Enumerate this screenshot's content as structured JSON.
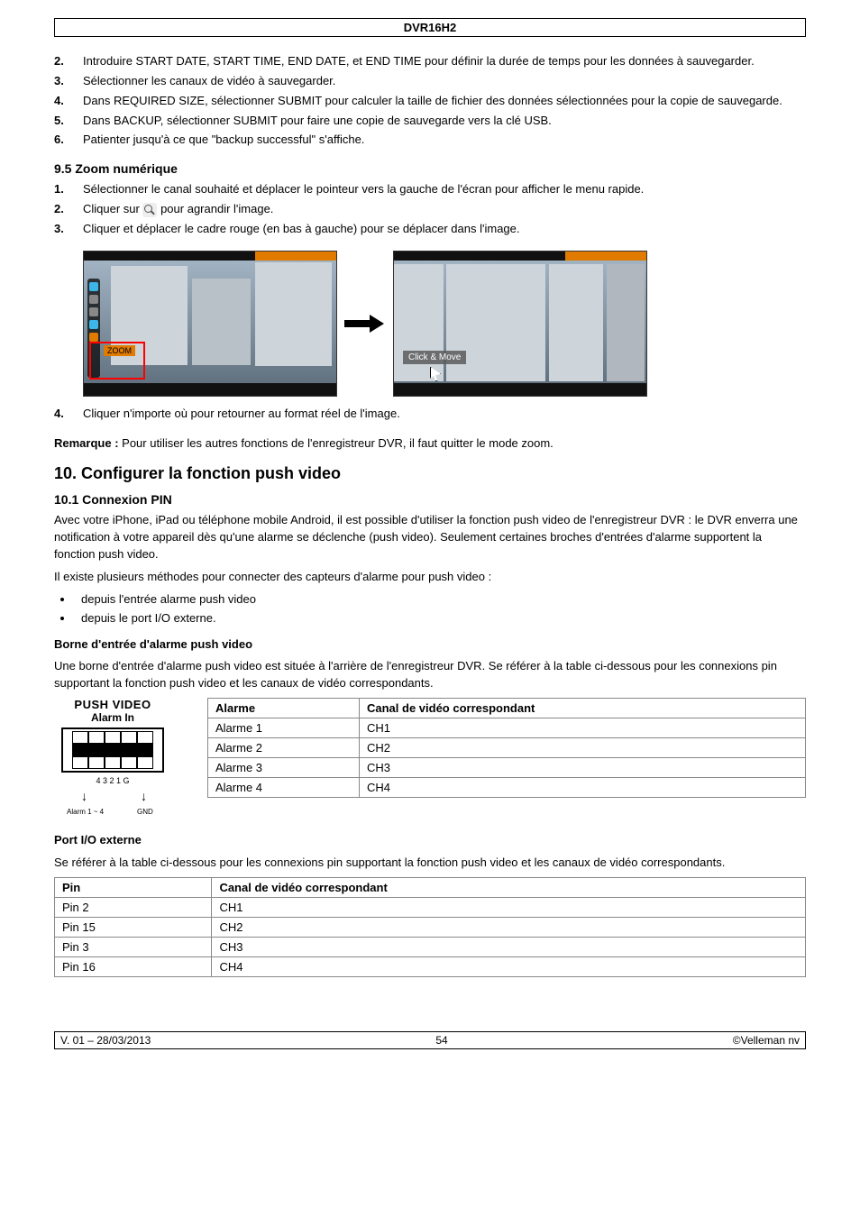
{
  "header": {
    "title": "DVR16H2"
  },
  "list1": {
    "items": [
      {
        "n": "2.",
        "t": "Introduire START DATE, START TIME, END DATE, et END TIME pour définir la durée de temps pour les données à sauvegarder."
      },
      {
        "n": "3.",
        "t": "Sélectionner les canaux de vidéo à sauvegarder."
      },
      {
        "n": "4.",
        "t": "Dans REQUIRED SIZE, sélectionner SUBMIT pour calculer la taille de fichier des données sélectionnées pour la copie de sauvegarde."
      },
      {
        "n": "5.",
        "t": "Dans BACKUP, sélectionner SUBMIT pour faire une copie de sauvegarde vers la clé USB."
      },
      {
        "n": "6.",
        "t": "Patienter jusqu'à ce que \"backup successful\" s'affiche."
      }
    ]
  },
  "sec95": {
    "heading": "9.5   Zoom numérique"
  },
  "list2": {
    "items": [
      {
        "n": "1.",
        "t": "Sélectionner le canal souhaité et déplacer le pointeur vers la gauche de l'écran pour afficher le menu rapide."
      },
      {
        "n": "2.",
        "pre": "Cliquer sur ",
        "post": " pour agrandir l'image."
      },
      {
        "n": "3.",
        "t": "Cliquer et déplacer le cadre rouge (en bas à gauche) pour se déplacer dans l'image."
      }
    ]
  },
  "shot": {
    "zoom": "ZOOM",
    "clickmove": "Click & Move"
  },
  "list3": {
    "items": [
      {
        "n": "4.",
        "t": "Cliquer n'importe où pour retourner au format réel de l'image."
      }
    ]
  },
  "remarque": {
    "label": "Remarque :",
    "text": " Pour utiliser les autres fonctions de l'enregistreur DVR, il faut quitter le mode zoom."
  },
  "chapter10": {
    "heading": "10.   Configurer la fonction push video"
  },
  "sec101": {
    "heading": "10.1  Connexion PIN"
  },
  "para101": {
    "p1": "Avec votre iPhone, iPad ou téléphone mobile Android, il est possible d'utiliser la fonction push video de l'enregistreur DVR : le DVR enverra une notification à votre appareil dès qu'une alarme se déclenche (push video). Seulement certaines broches d'entrées d'alarme supportent la fonction push video.",
    "p2": "Il existe plusieurs méthodes pour connecter des capteurs d'alarme pour push video :"
  },
  "bullets1": {
    "items": [
      "depuis l'entrée alarme push video",
      "depuis le port I/O externe."
    ]
  },
  "borne": {
    "heading": "Borne d'entrée d'alarme push video",
    "text": "Une borne d'entrée d'alarme push video est située à l'arrière de l'enregistreur DVR. Se référer à la table ci-dessous pour les connexions pin supportant la fonction push video et les canaux de vidéo correspondants."
  },
  "connector": {
    "title1": "PUSH VIDEO",
    "title2": "Alarm  In",
    "pins": "4  3  2  1  G",
    "label_alarm": "Alarm 1 ~ 4",
    "label_gnd": "GND"
  },
  "table1": {
    "h1": "Alarme",
    "h2": "Canal de vidéo correspondant",
    "rows": [
      {
        "a": "Alarme 1",
        "b": "CH1"
      },
      {
        "a": "Alarme 2",
        "b": "CH2"
      },
      {
        "a": "Alarme 3",
        "b": "CH3"
      },
      {
        "a": "Alarme 4",
        "b": "CH4"
      }
    ]
  },
  "portio": {
    "heading": "Port I/O externe",
    "text": "Se référer à la table ci-dessous pour les connexions pin supportant la fonction push video et les canaux de vidéo correspondants."
  },
  "table2": {
    "h1": "Pin",
    "h2": "Canal de vidéo correspondant",
    "rows": [
      {
        "a": "Pin 2",
        "b": "CH1"
      },
      {
        "a": "Pin 15",
        "b": "CH2"
      },
      {
        "a": "Pin 3",
        "b": "CH3"
      },
      {
        "a": "Pin 16",
        "b": "CH4"
      }
    ]
  },
  "footer": {
    "left": "V. 01 – 28/03/2013",
    "center": "54",
    "right": "©Velleman nv"
  }
}
